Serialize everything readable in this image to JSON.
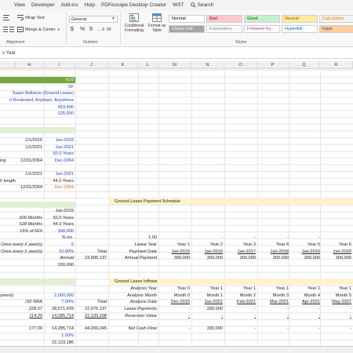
{
  "menu": [
    "View",
    "Developer",
    "Add-ins",
    "Help",
    "PDFescape Desktop Creator",
    "WST",
    "Search"
  ],
  "ribbon": {
    "wrap_text": "Wrap Text",
    "merge_center": "Merge & Center",
    "number_format": "General",
    "currency_symbol": "$",
    "percent_symbol": "%",
    "comma_symbol": "9",
    "inc_dec": "←.0 .00",
    "conditional_formatting": "Conditional Formatting",
    "format_as_table": "Format as Table",
    "alignment_label": "Alignment",
    "number_label": "Number",
    "styles_label": "Styles",
    "styles": [
      {
        "label": "Normal",
        "bg": "#ffffff",
        "fg": "#000000"
      },
      {
        "label": "Bad",
        "bg": "#ffc7ce",
        "fg": "#9c0006"
      },
      {
        "label": "Good",
        "bg": "#c6efce",
        "fg": "#006100"
      },
      {
        "label": "Neutral",
        "bg": "#ffeb9c",
        "fg": "#9c5700"
      },
      {
        "label": "Calculation",
        "bg": "#f2f2f2",
        "fg": "#fa7d00"
      },
      {
        "label": "Check Cell",
        "bg": "#a5a5a5",
        "fg": "#ffffff"
      },
      {
        "label": "Explanatory ...",
        "bg": "#ffffff",
        "fg": "#7f7f7f"
      },
      {
        "label": "Followed Hy...",
        "bg": "#ffffff",
        "fg": "#954f72"
      },
      {
        "label": "Hyperlink",
        "bg": "#ffffff",
        "fg": "#0563c1"
      },
      {
        "label": "Input",
        "bg": "#ffcc99",
        "fg": "#3f3f76"
      }
    ]
  },
  "formula_bar": {
    "text": "s Year"
  },
  "columns": [
    "H",
    "I",
    "J",
    "K",
    "L",
    "M",
    "N",
    "O",
    "P",
    "Q",
    "R"
  ],
  "cells": {
    "v10": "v1.0",
    "sf": "SF",
    "name": "Super Bullseye (Ground Lease)",
    "address": "h Boulevard, Anytown, Anywhere",
    "n653": "653,400",
    "n125": "125,000",
    "d1": "1/1/2015",
    "d1b": "Jan-2015",
    "d2": "1/1/2021",
    "d2b": "Jan-2021",
    "y50": "50.0 Years",
    "ing": "ing",
    "d3": "12/31/2064",
    "d3b": "Dec-2064",
    "d4": "1/1/2021",
    "d4b": "Jan-2021",
    "hlength": "h length",
    "y44": "44.0 Years",
    "d5": "12/31/2064",
    "d5b": "Dec-2064",
    "jan2015": "Jan-2015",
    "m600": "600 Months",
    "m600v": "50.0 Years",
    "m528": "528 Months",
    "m528v": "44.0 Years",
    "noi": "15% of NOI",
    "n300": "300,000",
    "inc": "% inc.",
    "once": "Once every X year(s)",
    "five": "5",
    "once2": "Once every X year(s)",
    "p10": "10.00%",
    "annual": "Annual",
    "n330": "330,000",
    "total_lbl": "Total",
    "total_val": "23,906,137",
    "sched_title": "Ground Lease Payment Schedule",
    "lease_year_lbl": "Lease Year",
    "pay_date_lbl": "Payment Date",
    "annual_pay_lbl": "Annual Payment",
    "one_00": "1.00",
    "inflow_title": "Ground Lease Inflows",
    "an_year": "Analysis Year",
    "an_month": "Analysis Month",
    "an_date": "Analysis Date",
    "lease_pay": "Lease Payments",
    "rev_val": "Reversion Value",
    "ncf": "Net Cash Flow",
    "total2": "Total",
    "payment_lbl": "yment)",
    "sfnra": "/SF NRA",
    "n2000": "2,000,000",
    "p7": "7.00%",
    "a1": "228.57",
    "a2": "28,571,429",
    "t1": "22,076,137",
    "b1": "114.29",
    "b2": "14,285,714",
    "t2": "22,133,108",
    "c1": "177.06",
    "c2": "14,285,714",
    "t3": "44,209,245",
    "p1": "1.00%",
    "last": "22,123,186"
  },
  "schedule": [
    {
      "year": "Year 1",
      "date": "Jan-2015",
      "pay": "300,000"
    },
    {
      "year": "Year 2",
      "date": "Jan-2016",
      "pay": "300,000"
    },
    {
      "year": "Year 3",
      "date": "Jan-2017",
      "pay": "300,000"
    },
    {
      "year": "Year 4",
      "date": "Jan-2018",
      "pay": "300,000"
    },
    {
      "year": "Year 5",
      "date": "Jan-2019",
      "pay": "300,000"
    },
    {
      "year": "Year 6",
      "date": "Jan-2020",
      "pay": "300,000"
    }
  ],
  "inflows": [
    {
      "year": "Year 0",
      "month": "Month 0",
      "date": "Dec-2010",
      "pay": "-",
      "rev": "-",
      "ncf": "-"
    },
    {
      "year": "Year 1",
      "month": "Month 1",
      "date": "Jan-2021",
      "pay": "330,000",
      "rev": "-",
      "ncf": "330,000"
    },
    {
      "year": "Year 1",
      "month": "Month 2",
      "date": "Feb-2021",
      "pay": "-",
      "rev": "-",
      "ncf": "-"
    },
    {
      "year": "Year 1",
      "month": "Month 3",
      "date": "Mar-2021",
      "pay": "-",
      "rev": "-",
      "ncf": "-"
    },
    {
      "year": "Year 1",
      "month": "Month 4",
      "date": "Apr-2021",
      "pay": "-",
      "rev": "-",
      "ncf": "-"
    },
    {
      "year": "Year 1",
      "month": "Month 5",
      "date": "May-2021",
      "pay": "-",
      "rev": "-",
      "ncf": "-"
    }
  ]
}
